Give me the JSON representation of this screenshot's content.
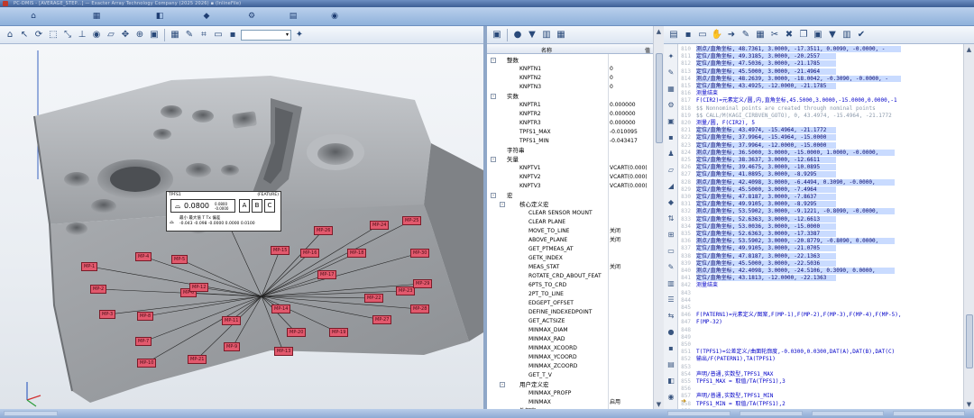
{
  "window": {
    "title": "PC-DMIS - [AVERAGE_STEP...] — Exacter Array Technology Company (2025 2026) ▪ (InlineFile)"
  },
  "tabstrip": {
    "icons": [
      "home-icon",
      "grid-icon",
      "cube-icon",
      "measure-icon",
      "gear-icon",
      "layers-icon",
      "camera-icon"
    ]
  },
  "graphics": {
    "toolbar_select": "",
    "callout": {
      "header_left": "TPFS1",
      "header_right": "(FEATURE)",
      "tolerance": "0.0800",
      "tol_small_top": "0.0800",
      "tol_small_bot": "-0.0000",
      "datums": [
        "A",
        "B",
        "C"
      ],
      "columns": "最小  最大值  T  Tx  偏差",
      "values": "-0.043  -0.098  -0.0000  0.0000    0.0100",
      "row_symbol": "⌓"
    },
    "labels": [
      "MP-1",
      "MP-2",
      "MP-3",
      "MP-4",
      "MP-5",
      "MP-6",
      "MP-7",
      "MP-8",
      "MP-9",
      "MP-10",
      "MP-11",
      "MP-12",
      "MP-13",
      "MP-14",
      "MP-15",
      "MP-16",
      "MP-17",
      "MP-18",
      "MP-19",
      "MP-20",
      "MP-21",
      "MP-22",
      "MP-23",
      "MP-24",
      "MP-25",
      "MP-26",
      "MP-27",
      "MP-28",
      "MP-29",
      "MP-30"
    ]
  },
  "tree": {
    "header_name": "名称",
    "header_value": "值",
    "rows": [
      {
        "name": "整数",
        "value": "",
        "level": 0,
        "group": true,
        "exp": "-"
      },
      {
        "name": "KNPTN1",
        "value": "0",
        "level": 1
      },
      {
        "name": "KNPTN2",
        "value": "0",
        "level": 1
      },
      {
        "name": "KNPTN3",
        "value": "0",
        "level": 1
      },
      {
        "name": "实数",
        "value": "",
        "level": 0,
        "group": true,
        "exp": "-"
      },
      {
        "name": "KNPTR1",
        "value": "0.000000",
        "level": 1
      },
      {
        "name": "KNPTR2",
        "value": "0.000000",
        "level": 1
      },
      {
        "name": "KNPTR3",
        "value": "0.000000",
        "level": 1
      },
      {
        "name": "TPFS1_MAX",
        "value": "-0.010095",
        "level": 1
      },
      {
        "name": "TPFS1_MIN",
        "value": "-0.043417",
        "level": 1
      },
      {
        "name": "字符串",
        "value": "",
        "level": 0,
        "group": true,
        "exp": ""
      },
      {
        "name": "矢量",
        "value": "",
        "level": 0,
        "group": true,
        "exp": "-"
      },
      {
        "name": "KNPTV1",
        "value": "VCART(0.000(",
        "level": 1
      },
      {
        "name": "KNPTV2",
        "value": "VCART(0.000(",
        "level": 1
      },
      {
        "name": "KNPTV3",
        "value": "VCART(0.000(",
        "level": 1
      },
      {
        "name": "宏",
        "value": "",
        "level": 0,
        "group": true,
        "exp": "-"
      },
      {
        "name": "核心定义宏",
        "value": "",
        "level": 1,
        "group": true,
        "exp": "-"
      },
      {
        "name": "CLEAR SENSOR MOUNT",
        "value": "",
        "level": 2
      },
      {
        "name": "CLEAR PLANE",
        "value": "",
        "level": 2
      },
      {
        "name": "MOVE_TO_LINE",
        "value": "关闭",
        "level": 2
      },
      {
        "name": "ABOVE_PLANE",
        "value": "关闭",
        "level": 2
      },
      {
        "name": "GET_PTMEAS_AT",
        "value": "",
        "level": 2
      },
      {
        "name": "GETK_INDEX",
        "value": "",
        "level": 2
      },
      {
        "name": "MEAS_STAT",
        "value": "关闭",
        "level": 2
      },
      {
        "name": "ROTATE_CRD_ABOUT_FEAT",
        "value": "",
        "level": 2
      },
      {
        "name": "6PTS_TO_CRD",
        "value": "",
        "level": 2
      },
      {
        "name": "2PT_TO_LINE",
        "value": "",
        "level": 2
      },
      {
        "name": "EDGEPT_OFFSET",
        "value": "",
        "level": 2
      },
      {
        "name": "DEFINE_INDEXEDPOINT",
        "value": "",
        "level": 2
      },
      {
        "name": "GET_ACTSIZE",
        "value": "",
        "level": 2
      },
      {
        "name": "MINMAX_DIAM",
        "value": "",
        "level": 2
      },
      {
        "name": "MINMAX_RAD",
        "value": "",
        "level": 2
      },
      {
        "name": "MINMAX_XCOORD",
        "value": "",
        "level": 2
      },
      {
        "name": "MINMAX_YCOORD",
        "value": "",
        "level": 2
      },
      {
        "name": "MINMAX_ZCOORD",
        "value": "",
        "level": 2
      },
      {
        "name": "GET_T_V",
        "value": "",
        "level": 2
      },
      {
        "name": "用户定义宏",
        "value": "",
        "level": 1,
        "group": true,
        "exp": "-"
      },
      {
        "name": "MINMAX_PROFP",
        "value": "",
        "level": 2
      },
      {
        "name": "MINMAX",
        "value": "启用",
        "level": 2
      },
      {
        "name": "外部宏",
        "value": "",
        "level": 1
      }
    ]
  },
  "editor": {
    "lines": [
      {
        "n": "810",
        "t": "      测点/直角坐标, 48.7361,   3.0000, -17.3511,  0.0090, -0.0000, -",
        "c": "hl"
      },
      {
        "n": "811",
        "t": "      定位/直角坐标,  49.3185,   3.0000, -20.2557",
        "c": "hl"
      },
      {
        "n": "812",
        "t": "      定位/直角坐标,  47.5036,   3.0000, -21.1785",
        "c": "hl"
      },
      {
        "n": "813",
        "t": "      定位/直角坐标,  45.5000,   3.0000, -21.4964",
        "c": "hl"
      },
      {
        "n": "814",
        "t": "      测点/直角坐标, 48.2639,   3.0000, -18.0042, -0.3090, -0.0000, -",
        "c": "hl"
      },
      {
        "n": "815",
        "t": "      定位/直角坐标,  43.4925, -12.0000, -21.1785",
        "c": "hl"
      },
      {
        "n": "816",
        "t": "   测量结束",
        "c": "blue"
      },
      {
        "n": "817",
        "t": "F(CIR2)=元素定义/圆,内,直角坐标,45.5000,3.0000,-15.0000,0.0000,-1",
        "c": "blue"
      },
      {
        "n": "818",
        "t": "$$ Nonnominal points are created through nominal points",
        "c": "cmt"
      },
      {
        "n": "819",
        "t": "$$ CALL/M(KAGI_CIRBVEN_GOTO), 0, 43.4974, -15.4964, -21.1772",
        "c": "cmt"
      },
      {
        "n": "820",
        "t": "   测量/圆, F(CIR2), 5",
        "c": "blue"
      },
      {
        "n": "821",
        "t": "      定位/直角坐标,  43.4974, -15.4964, -21.1772",
        "c": "hl"
      },
      {
        "n": "822",
        "t": "      定位/直角坐标,  37.9964, -15.4964, -15.0000",
        "c": "hl"
      },
      {
        "n": "823",
        "t": "      定位/直角坐标,  37.9964, -12.0000, -15.0000",
        "c": "hl"
      },
      {
        "n": "824",
        "t": "      测点/直角坐标, 36.5000,   3.0000, -15.0000,  1.0000, -0.0000,",
        "c": "hl"
      },
      {
        "n": "825",
        "t": "      定位/直角坐标,  38.3637,   3.0000, -12.6611",
        "c": "hl"
      },
      {
        "n": "826",
        "t": "      定位/直角坐标,  39.4675,   3.0000, -10.0895",
        "c": "hl"
      },
      {
        "n": "827",
        "t": "      定位/直角坐标,  41.0895,   3.0000,  -8.9295",
        "c": "hl"
      },
      {
        "n": "828",
        "t": "      测点/直角坐标, 42.4098,   3.0000,  -6.4494,  0.3090, -0.0000,",
        "c": "hl"
      },
      {
        "n": "829",
        "t": "      定位/直角坐标,  45.5000,   3.0000,  -7.4964",
        "c": "hl"
      },
      {
        "n": "830",
        "t": "      定位/直角坐标,  47.8187,   3.0000,  -7.8637",
        "c": "hl"
      },
      {
        "n": "831",
        "t": "      定位/直角坐标,  49.9105,   3.0000,  -8.9295",
        "c": "hl"
      },
      {
        "n": "832",
        "t": "      测点/直角坐标, 53.5902,   3.0000,  -9.1221, -0.8090, -0.0000,",
        "c": "hl"
      },
      {
        "n": "833",
        "t": "      定位/直角坐标,  52.6363,   3.0000, -12.6613",
        "c": "hl"
      },
      {
        "n": "834",
        "t": "      定位/直角坐标,  53.0036,   3.0000, -15.0000",
        "c": "hl"
      },
      {
        "n": "835",
        "t": "      定位/直角坐标,  52.6363,   3.0000, -17.3387",
        "c": "hl"
      },
      {
        "n": "836",
        "t": "      测点/直角坐标, 53.5902,   3.0000, -20.8779, -0.8090,  0.0000,",
        "c": "hl"
      },
      {
        "n": "837",
        "t": "      定位/直角坐标,  49.9105,   3.0000, -21.0705",
        "c": "hl"
      },
      {
        "n": "838",
        "t": "      定位/直角坐标,  47.8187,   3.0000, -22.1363",
        "c": "hl"
      },
      {
        "n": "839",
        "t": "      定位/直角坐标,  45.5000,   3.0000, -22.5036",
        "c": "hl"
      },
      {
        "n": "840",
        "t": "      测点/直角坐标, 42.4098,   3.0000, -24.5106,  0.3090,  0.0000,",
        "c": "hl"
      },
      {
        "n": "841",
        "t": "      定位/直角坐标,  43.1813, -12.0000, -22.1363",
        "c": "hl"
      },
      {
        "n": "842",
        "t": "   测量结束",
        "c": "blue"
      },
      {
        "n": "843",
        "t": "",
        "c": ""
      },
      {
        "n": "844",
        "t": "",
        "c": ""
      },
      {
        "n": "845",
        "t": "",
        "c": ""
      },
      {
        "n": "846",
        "t": "F(PATERN1)=元素定义/图案,F(MP-1),F(MP-2),F(MP-3),F(MP-4),F(MP-5),",
        "c": "blue"
      },
      {
        "n": "847",
        "t": "       F(MP-32)",
        "c": "blue"
      },
      {
        "n": "848",
        "t": "",
        "c": ""
      },
      {
        "n": "849",
        "t": "",
        "c": ""
      },
      {
        "n": "850",
        "t": "",
        "c": ""
      },
      {
        "n": "851",
        "t": "T(TPFS1)=公差定义/曲面轮廓度,-0.0300,0.0300,DAT(A),DAT(B),DAT(C)",
        "c": "blue"
      },
      {
        "n": "852",
        "t": "输出/F(PATERN1),TA(TPFS1)",
        "c": "blue"
      },
      {
        "n": "853",
        "t": "",
        "c": ""
      },
      {
        "n": "854",
        "t": "声明/普通,实数型,TPFS1_MAX",
        "c": "blue"
      },
      {
        "n": "855",
        "t": "TPFS1_MAX = 取值/TA(TPFS1),3",
        "c": "blue"
      },
      {
        "n": "856",
        "t": "",
        "c": ""
      },
      {
        "n": "857",
        "t": "声明/普通,实数型,TPFS1_MIN",
        "c": "blue"
      },
      {
        "n": "858",
        "t": "TPFS1_MIN = 取值/TA(TPFS1),2",
        "c": "blue"
      },
      {
        "n": "859",
        "t": "",
        "c": ""
      }
    ]
  },
  "colors": {
    "label_fill": "#e2596d",
    "current_line": "#1d8a2f",
    "code_blue": "#0000c8"
  }
}
